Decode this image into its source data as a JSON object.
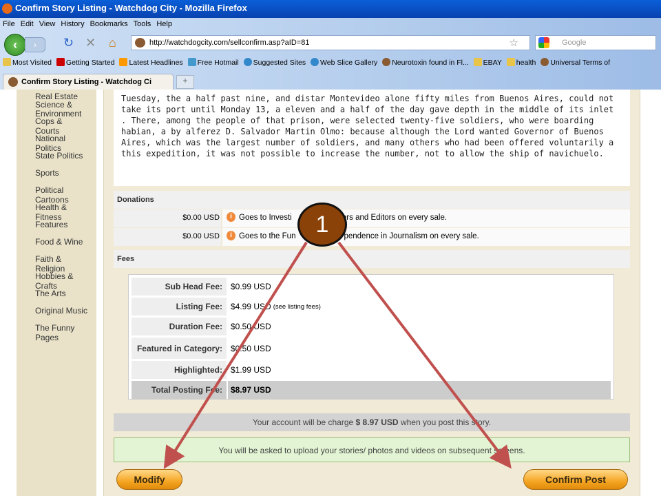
{
  "window": {
    "title": "Confirm Story Listing - Watchdog City - Mozilla Firefox"
  },
  "menu": [
    "File",
    "Edit",
    "View",
    "History",
    "Bookmarks",
    "Tools",
    "Help"
  ],
  "url": "http://watchdogcity.com/sellconfirm.asp?aID=81",
  "search_placeholder": "Google",
  "bookmarks": [
    "Most Visited",
    "Getting Started",
    "Latest Headlines",
    "Free Hotmail",
    "Suggested Sites",
    "Web Slice Gallery",
    "Neurotoxin found in Fl...",
    "EBAY",
    "health",
    "Universal Terms of"
  ],
  "tab": {
    "title": "Confirm Story Listing - Watchdog Ci",
    "new": "+"
  },
  "sidebar": [
    "Real Estate",
    "Science &",
    "Environment",
    "Cops &",
    "Courts",
    "National",
    "Politics",
    "State Politics",
    "Sports",
    "Political",
    "Cartoons",
    "Health &",
    "Fitness",
    "Features",
    "Food & Wine",
    "Faith &",
    "Religion",
    "Hobbies &",
    "Crafts",
    "The Arts",
    "Original Music",
    "The Funny",
    "Pages"
  ],
  "story": "Tuesday, the a half past nine, and distar Montevideo alone fifty miles from Buenos Aires, could not take its port until Monday 13, a eleven and a half of the day gave depth in the middle of its inlet . There, among the people of that prison, were selected twenty-five soldiers, who were boarding habian, a by alferez D. Salvador Martin Olmo: because although the Lord wanted Governor of Buenos Aires, which was the largest number of soldiers, and many others who had been offered voluntarily a this expedition, it was not possible to increase the number, not to allow the ship of navichuelo.",
  "donations": {
    "title": "Donations",
    "rows": [
      {
        "amount": "$0.00 USD",
        "desc_a": "Goes to Investi",
        "desc_b": "ters and Editors on every sale."
      },
      {
        "amount": "$0.00 USD",
        "desc_a": "Goes to the Fun",
        "desc_b": "pendence in Journalism on every sale."
      }
    ]
  },
  "fees": {
    "title": "Fees",
    "rows": [
      {
        "label": "Sub Head Fee:",
        "value": "$0.99 USD",
        "note": ""
      },
      {
        "label": "Listing Fee:",
        "value": "$4.99 USD",
        "note": "(see listing fees)"
      },
      {
        "label": "Duration Fee:",
        "value": "$0.50 USD",
        "note": ""
      },
      {
        "label": "Featured in Category:",
        "value": "$0.50 USD",
        "note": ""
      },
      {
        "label": "Highlighted:",
        "value": "$1.99 USD",
        "note": ""
      },
      {
        "label": "Total Posting Fee:",
        "value": "$8.97 USD",
        "note": ""
      }
    ]
  },
  "charge": {
    "pre": "Your account will be charge",
    "amount": "$ 8.97 USD",
    "post": "when you post this story."
  },
  "upload_note": "You will be asked to upload your stories/ photos and videos on subsequent screens.",
  "buttons": {
    "modify": "Modify",
    "confirm": "Confirm Post"
  },
  "annotation": {
    "number": "1"
  }
}
